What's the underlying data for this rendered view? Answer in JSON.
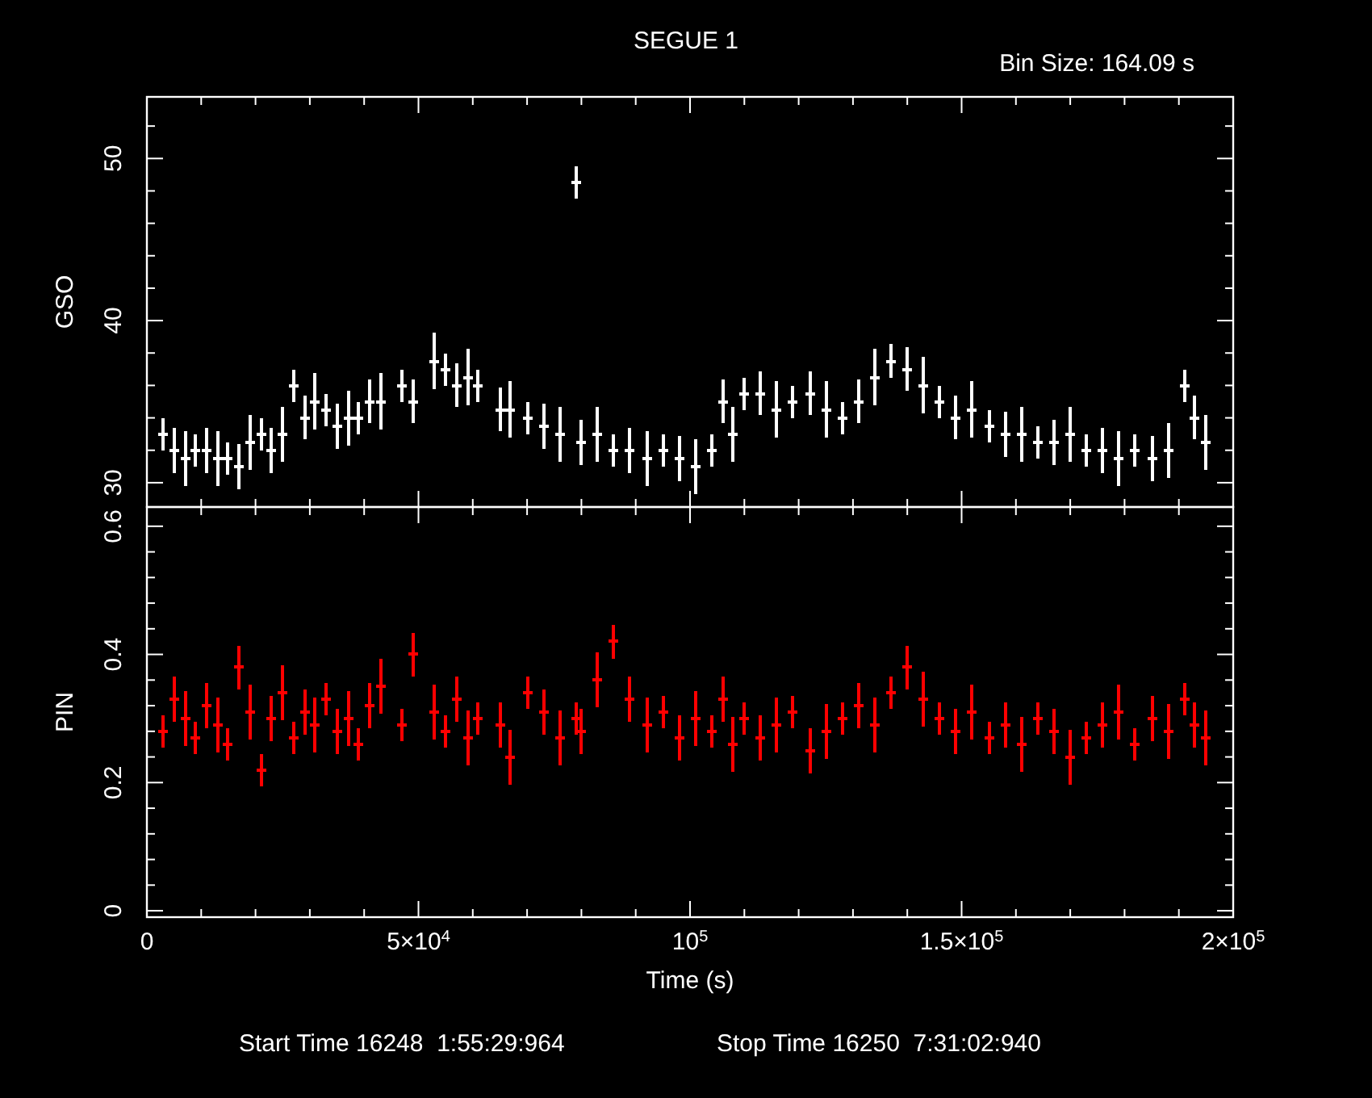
{
  "title": "SEGUE 1",
  "bin_size": "Bin Size: 164.09 s",
  "panels": [
    {
      "chart_data": {
        "type": "scatter",
        "xlim": [
          0,
          200000
        ],
        "ylim": [
          28.5,
          53.8
        ],
        "yticks": [
          30,
          40,
          50
        ],
        "x": [
          3000,
          5000,
          7000,
          9000,
          11000,
          13000,
          15000,
          17000,
          19000,
          21000,
          23000,
          25000,
          27000,
          29000,
          31000,
          33000,
          35000,
          37000,
          39000,
          41000,
          43000,
          47000,
          49000,
          53000,
          55000,
          57000,
          59000,
          61000,
          65000,
          67000,
          70000,
          73000,
          76000,
          79000,
          80000,
          83000,
          86000,
          89000,
          92000,
          95000,
          98000,
          101000,
          104000,
          106000,
          108000,
          110000,
          113000,
          116000,
          119000,
          122000,
          125000,
          128000,
          131000,
          134000,
          137000,
          140000,
          143000,
          146000,
          149000,
          152000,
          155000,
          158000,
          161000,
          164000,
          167000,
          170000,
          173000,
          176000,
          179000,
          182000,
          185000,
          188000,
          191000,
          193000,
          195000
        ],
        "series": [
          {
            "name": "GSO",
            "color": "#ffffff",
            "values": [
              33,
              32,
              31.5,
              32,
              32,
              31.5,
              31.5,
              31,
              32.5,
              33,
              32,
              33,
              36,
              34,
              35,
              34.5,
              33.5,
              34,
              34,
              35,
              35,
              36,
              35,
              37.5,
              37,
              36,
              36.5,
              36,
              34.5,
              34.5,
              34,
              33.5,
              33,
              48.5,
              32.5,
              33,
              32,
              32,
              31.5,
              32,
              31.5,
              31,
              32,
              35,
              33,
              35.5,
              35.5,
              34.5,
              35,
              35.5,
              34.5,
              34,
              35,
              36.5,
              37.5,
              37,
              36,
              35,
              34,
              34.5,
              33.5,
              33,
              33,
              32.5,
              32.5,
              33,
              32,
              32,
              31.5,
              32,
              31.5,
              32,
              36,
              34,
              32.5
            ]
          }
        ]
      }
    },
    {
      "chart_data": {
        "type": "scatter",
        "xlabel": "Time (s)",
        "xlim": [
          0,
          200000
        ],
        "ylim": [
          -0.01,
          0.63
        ],
        "yticks": [
          0,
          0.2,
          0.4,
          0.6
        ],
        "xticks": [
          {
            "value": 0,
            "label": "0"
          },
          {
            "value": 50000,
            "label": "5×10$^{4}$"
          },
          {
            "value": 100000,
            "label": "10$^{5}$"
          },
          {
            "value": 150000,
            "label": "1.5×10$^{5}$"
          },
          {
            "value": 200000,
            "label": "2×10$^{5}$"
          }
        ],
        "x": [
          3000,
          5000,
          7000,
          9000,
          11000,
          13000,
          15000,
          17000,
          19000,
          21000,
          23000,
          25000,
          27000,
          29000,
          31000,
          33000,
          35000,
          37000,
          39000,
          41000,
          43000,
          47000,
          49000,
          53000,
          55000,
          57000,
          59000,
          61000,
          65000,
          67000,
          70000,
          73000,
          76000,
          79000,
          80000,
          83000,
          86000,
          89000,
          92000,
          95000,
          98000,
          101000,
          104000,
          106000,
          108000,
          110000,
          113000,
          116000,
          119000,
          122000,
          125000,
          128000,
          131000,
          134000,
          137000,
          140000,
          143000,
          146000,
          149000,
          152000,
          155000,
          158000,
          161000,
          164000,
          167000,
          170000,
          173000,
          176000,
          179000,
          182000,
          185000,
          188000,
          191000,
          193000,
          195000
        ],
        "series": [
          {
            "name": "PIN",
            "color": "#ff0000",
            "values": [
              0.28,
              0.33,
              0.3,
              0.27,
              0.32,
              0.29,
              0.26,
              0.38,
              0.31,
              0.22,
              0.3,
              0.34,
              0.27,
              0.31,
              0.29,
              0.33,
              0.28,
              0.3,
              0.26,
              0.32,
              0.35,
              0.29,
              0.4,
              0.31,
              0.28,
              0.33,
              0.27,
              0.3,
              0.29,
              0.24,
              0.34,
              0.31,
              0.27,
              0.3,
              0.28,
              0.36,
              0.42,
              0.33,
              0.29,
              0.31,
              0.27,
              0.3,
              0.28,
              0.33,
              0.26,
              0.3,
              0.27,
              0.29,
              0.31,
              0.25,
              0.28,
              0.3,
              0.32,
              0.29,
              0.34,
              0.38,
              0.33,
              0.3,
              0.28,
              0.31,
              0.27,
              0.29,
              0.26,
              0.3,
              0.28,
              0.24,
              0.27,
              0.29,
              0.31,
              0.26,
              0.3,
              0.28,
              0.33,
              0.29,
              0.27
            ]
          }
        ]
      }
    }
  ],
  "start_time": "Start Time 16248  1:55:29:964",
  "stop_time": "Stop Time 16250  7:31:02:940"
}
